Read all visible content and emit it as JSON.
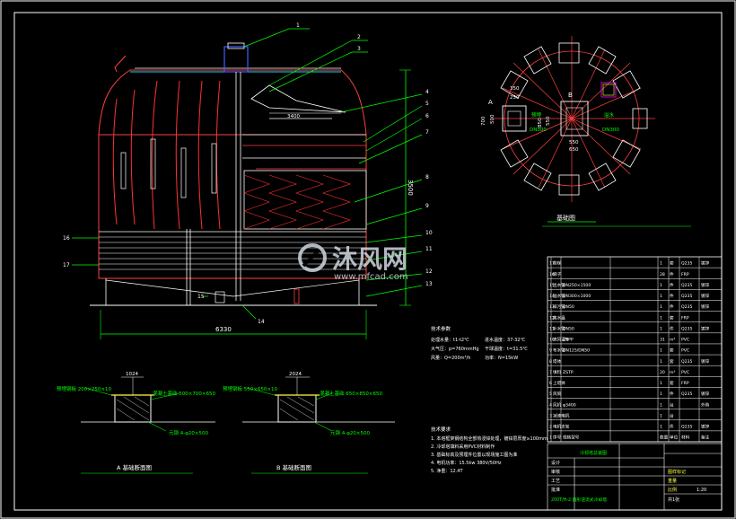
{
  "colors": {
    "background": "#000000",
    "frame": "#ffffff",
    "outline": "#ff4040",
    "hatch": "#ff3030",
    "leader": "#00ff00",
    "dimension": "#00ff00",
    "annotation": "#ffffff",
    "accent_blue": "#4060ff",
    "cyan": "#00e0ff",
    "magenta": "#ff00ff",
    "yellow": "#ffff40",
    "watermark": "#cfd8e0"
  },
  "callouts": [
    "1",
    "2",
    "3",
    "4",
    "5",
    "6",
    "7",
    "8",
    "9",
    "10",
    "11",
    "12",
    "13",
    "14",
    "15",
    "16",
    "17"
  ],
  "dimensions": {
    "overall_width": "6330",
    "overall_height": "3500",
    "fan_width": "3400"
  },
  "plan_view": {
    "title": "基础图",
    "label_a": "A",
    "label_b": "B",
    "dims": [
      "350",
      "250",
      "500",
      "700",
      "550",
      "850",
      "550",
      "650"
    ],
    "notes": [
      "预埋",
      "DN300",
      "溢水",
      "DN300"
    ]
  },
  "foundation_a": {
    "title": "A 基础断面图",
    "dim_top": "1024",
    "label_steel": "预埋钢板 200×250×10",
    "label_concrete": "混凝土基础 500×700×650",
    "label_bolt": "元钢 4-φ20×500"
  },
  "foundation_b": {
    "title": "B 基础断面图",
    "dim_top": "2024",
    "label_steel": "预埋钢板 550×650×10",
    "label_concrete": "混凝土基础 650×850×650",
    "label_bolt": "元钢 4-φ20×500"
  },
  "tech_params": {
    "heading": "技术参数",
    "rows": [
      "处理水量：t1-t2℃",
      "进水温度：37-32℃",
      "大气压：p=760mmHg",
      "干球温度：t=31.5℃",
      "风量：Q=200m³/h",
      "功率：N=15kW"
    ]
  },
  "tech_reqs": {
    "heading": "技术要求",
    "rows": [
      "1. 本塔框架钢结构全部热浸锌处理，镀锌层厚度≥100mm",
      "2. 冷却塔填料采用PVC材料制作",
      "3. 基础标高及预埋件位置以现场施工图为准",
      "4. 电机功率：15.5kw  380V/50Hz",
      "5. 净重：12.4T"
    ]
  },
  "watermark": {
    "brand": "沐风网",
    "url": "www.mfcad.com"
  },
  "bom": {
    "rows": [
      {
        "no": "17",
        "name": "爬梯",
        "spec": "",
        "qty": "1",
        "unit": "套",
        "material": "Q235",
        "remark": "镀锌"
      },
      {
        "no": "16",
        "name": "梯子",
        "spec": "",
        "qty": "28",
        "unit": "件",
        "material": "FRP",
        "remark": ""
      },
      {
        "no": "15",
        "name": "出水管",
        "spec": "DN250×1500",
        "qty": "1",
        "unit": "件",
        "material": "Q235",
        "remark": "镀锌"
      },
      {
        "no": "14",
        "name": "溢水管",
        "spec": "DN300×1000",
        "qty": "1",
        "unit": "件",
        "material": "Q235",
        "remark": "镀锌"
      },
      {
        "no": "13",
        "name": "排污管",
        "spec": "DN50",
        "qty": "1",
        "unit": "件",
        "material": "Q235",
        "remark": "镀锌"
      },
      {
        "no": "12",
        "name": "集水盘",
        "spec": "",
        "qty": "1",
        "unit": "套",
        "material": "FRP",
        "remark": ""
      },
      {
        "no": "11",
        "name": "补水管",
        "spec": "DN50",
        "qty": "1",
        "unit": "件",
        "material": "Q235",
        "remark": "镀锌"
      },
      {
        "no": "10",
        "name": "进风百叶",
        "spec": "ZSPP",
        "qty": "31",
        "unit": "m²",
        "material": "PVC",
        "remark": ""
      },
      {
        "no": "9",
        "name": "布水管",
        "spec": "DN125/DN50",
        "qty": "1",
        "unit": "套",
        "material": "PVC",
        "remark": ""
      },
      {
        "no": "8",
        "name": "塔体",
        "spec": "",
        "qty": "1",
        "unit": "套",
        "material": "Q235",
        "remark": "镀锌"
      },
      {
        "no": "7",
        "name": "填料",
        "spec": "ZSTP",
        "qty": "20",
        "unit": "m³",
        "material": "PVC",
        "remark": ""
      },
      {
        "no": "6",
        "name": "上塔体",
        "spec": "",
        "qty": "1",
        "unit": "套",
        "material": "FRP",
        "remark": ""
      },
      {
        "no": "5",
        "name": "风筒",
        "spec": "",
        "qty": "1",
        "unit": "件",
        "material": "Q235",
        "remark": "镀锌"
      },
      {
        "no": "4",
        "name": "风机",
        "spec": "φ3400",
        "qty": "1",
        "unit": "台",
        "material": "",
        "remark": "外购"
      },
      {
        "no": "3",
        "name": "减速电机",
        "spec": "",
        "qty": "1",
        "unit": "台",
        "material": "",
        "remark": ""
      },
      {
        "no": "2",
        "name": "电机支架",
        "spec": "",
        "qty": "1",
        "unit": "件",
        "material": "Q235",
        "remark": "镀锌"
      },
      {
        "no": "1",
        "name": "序号",
        "spec": "规格型号",
        "qty": "数量",
        "unit": "单位",
        "material": "材料",
        "remark": "备注"
      }
    ]
  },
  "title_block": {
    "project": "冷却塔总装图",
    "drawing_name": "200T/H-2 圆形逆流式冷却塔",
    "cells": [
      "设计",
      "审核",
      "工艺",
      "批准"
    ],
    "right_cells": [
      "图样标记",
      "重量",
      "比例"
    ],
    "scale": "1:20",
    "sheet": "共1张"
  }
}
